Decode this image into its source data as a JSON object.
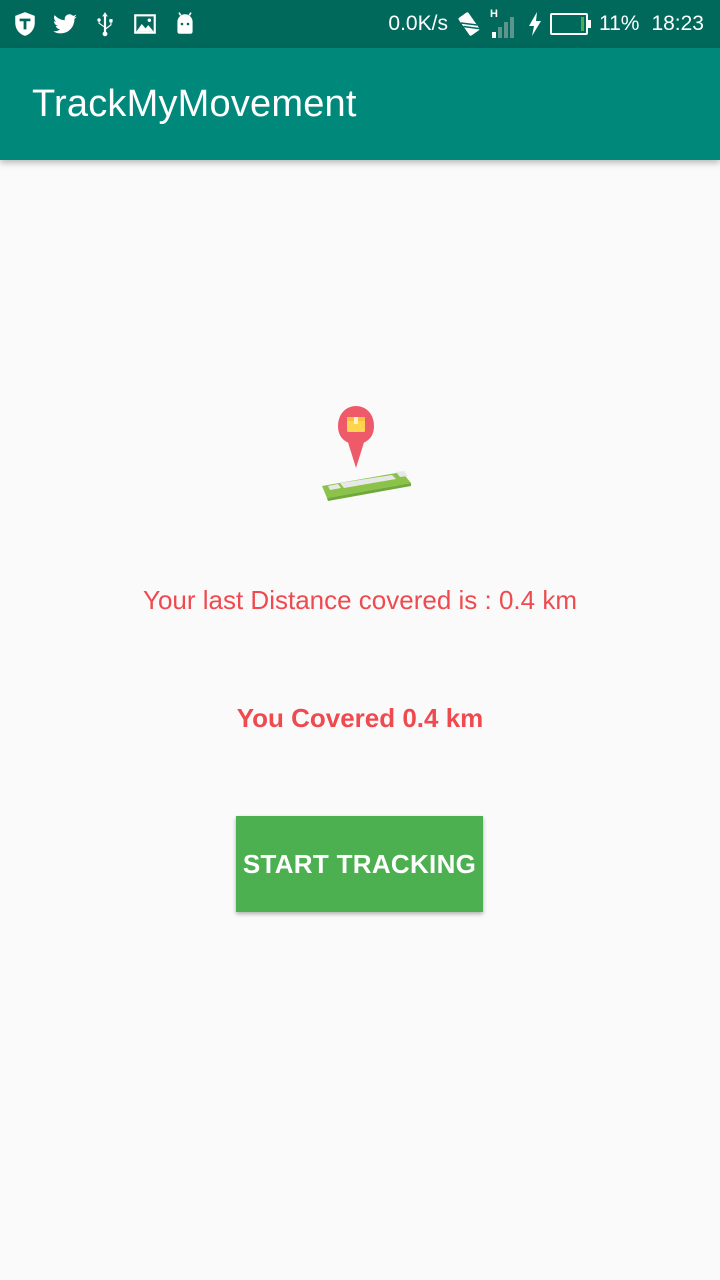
{
  "status_bar": {
    "left_icons": [
      "shield-icon",
      "twitter-icon",
      "usb-icon",
      "image-icon",
      "android-icon"
    ],
    "network_speed": "0.0K/s",
    "network_type": "H",
    "battery_percent": "11%",
    "battery_level": 0.11,
    "time": "18:23"
  },
  "app_bar": {
    "title": "TrackMyMovement"
  },
  "main": {
    "illustration_icon": "map-location-pin-icon",
    "last_distance_text": "Your last Distance covered is : 0.4 km",
    "covered_text": "You Covered 0.4 km",
    "start_button_label": "START TRACKING"
  },
  "colors": {
    "status_bar": "#00695c",
    "app_bar": "#00897b",
    "text_accent": "#ef4a4f",
    "button": "#4caf50",
    "background": "#fafafa"
  }
}
